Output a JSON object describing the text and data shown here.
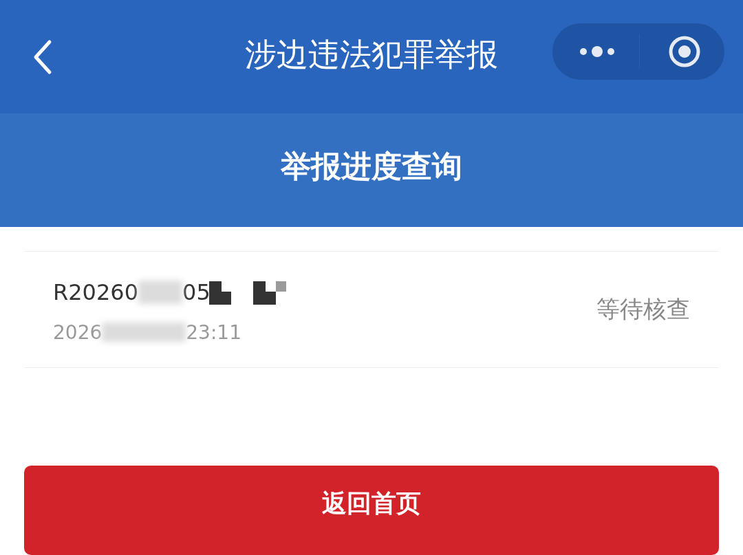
{
  "nav_bar": {
    "title": "涉边违法犯罪举报"
  },
  "header": {
    "title": "举报进度查询"
  },
  "records": [
    {
      "id_parts": [
        "R20260",
        "05"
      ],
      "time_parts": [
        "2026",
        "23:11"
      ],
      "status": "等待核查"
    }
  ],
  "buttons": [
    {
      "label": "返回首页"
    }
  ]
}
